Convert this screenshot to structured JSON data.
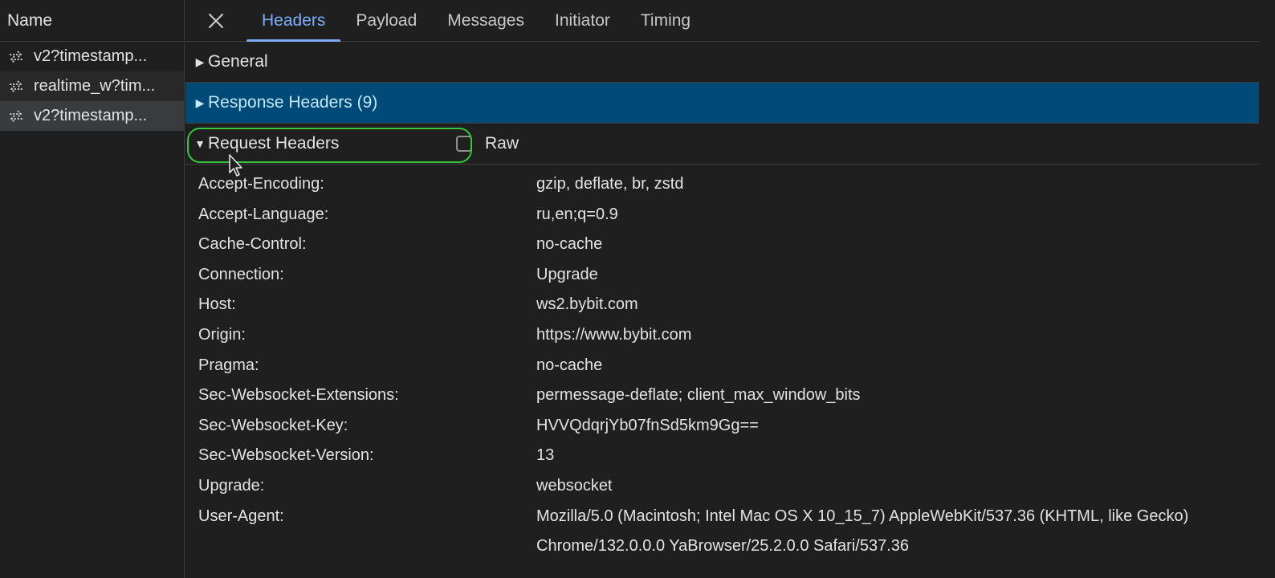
{
  "network_list": {
    "column_header": "Name",
    "requests": [
      {
        "name": "v2?timestamp...",
        "icon": "websocket-icon"
      },
      {
        "name": "realtime_w?tim...",
        "icon": "websocket-icon"
      },
      {
        "name": "v2?timestamp...",
        "icon": "websocket-icon"
      }
    ]
  },
  "tabs": {
    "close_icon": "close-icon",
    "items": [
      "Headers",
      "Payload",
      "Messages",
      "Initiator",
      "Timing"
    ],
    "active": "Headers"
  },
  "sections": {
    "general": {
      "label": "General",
      "expanded": false
    },
    "response_headers": {
      "label": "Response Headers (9)",
      "expanded": false
    },
    "request_headers": {
      "label": "Request Headers",
      "expanded": true,
      "raw_label": "Raw",
      "raw_checked": false
    }
  },
  "request_headers": [
    {
      "key": "Accept-Encoding:",
      "value": "gzip, deflate, br, zstd"
    },
    {
      "key": "Accept-Language:",
      "value": "ru,en;q=0.9"
    },
    {
      "key": "Cache-Control:",
      "value": "no-cache"
    },
    {
      "key": "Connection:",
      "value": "Upgrade"
    },
    {
      "key": "Host:",
      "value": "ws2.bybit.com"
    },
    {
      "key": "Origin:",
      "value": "https://www.bybit.com"
    },
    {
      "key": "Pragma:",
      "value": "no-cache"
    },
    {
      "key": "Sec-Websocket-Extensions:",
      "value": "permessage-deflate; client_max_window_bits"
    },
    {
      "key": "Sec-Websocket-Key:",
      "value": "HVVQdqrjYb07fnSd5km9Gg=="
    },
    {
      "key": "Sec-Websocket-Version:",
      "value": "13"
    },
    {
      "key": "Upgrade:",
      "value": "websocket"
    },
    {
      "key": "User-Agent:",
      "value": "Mozilla/5.0 (Macintosh; Intel Mac OS X 10_15_7) AppleWebKit/537.36 (KHTML, like Gecko) Chrome/132.0.0.0 YaBrowser/25.2.0.0 Safari/537.36"
    }
  ],
  "colors": {
    "accent": "#7cacf8",
    "highlight_bg": "#004a77",
    "focus_ring": "#34c63b"
  }
}
